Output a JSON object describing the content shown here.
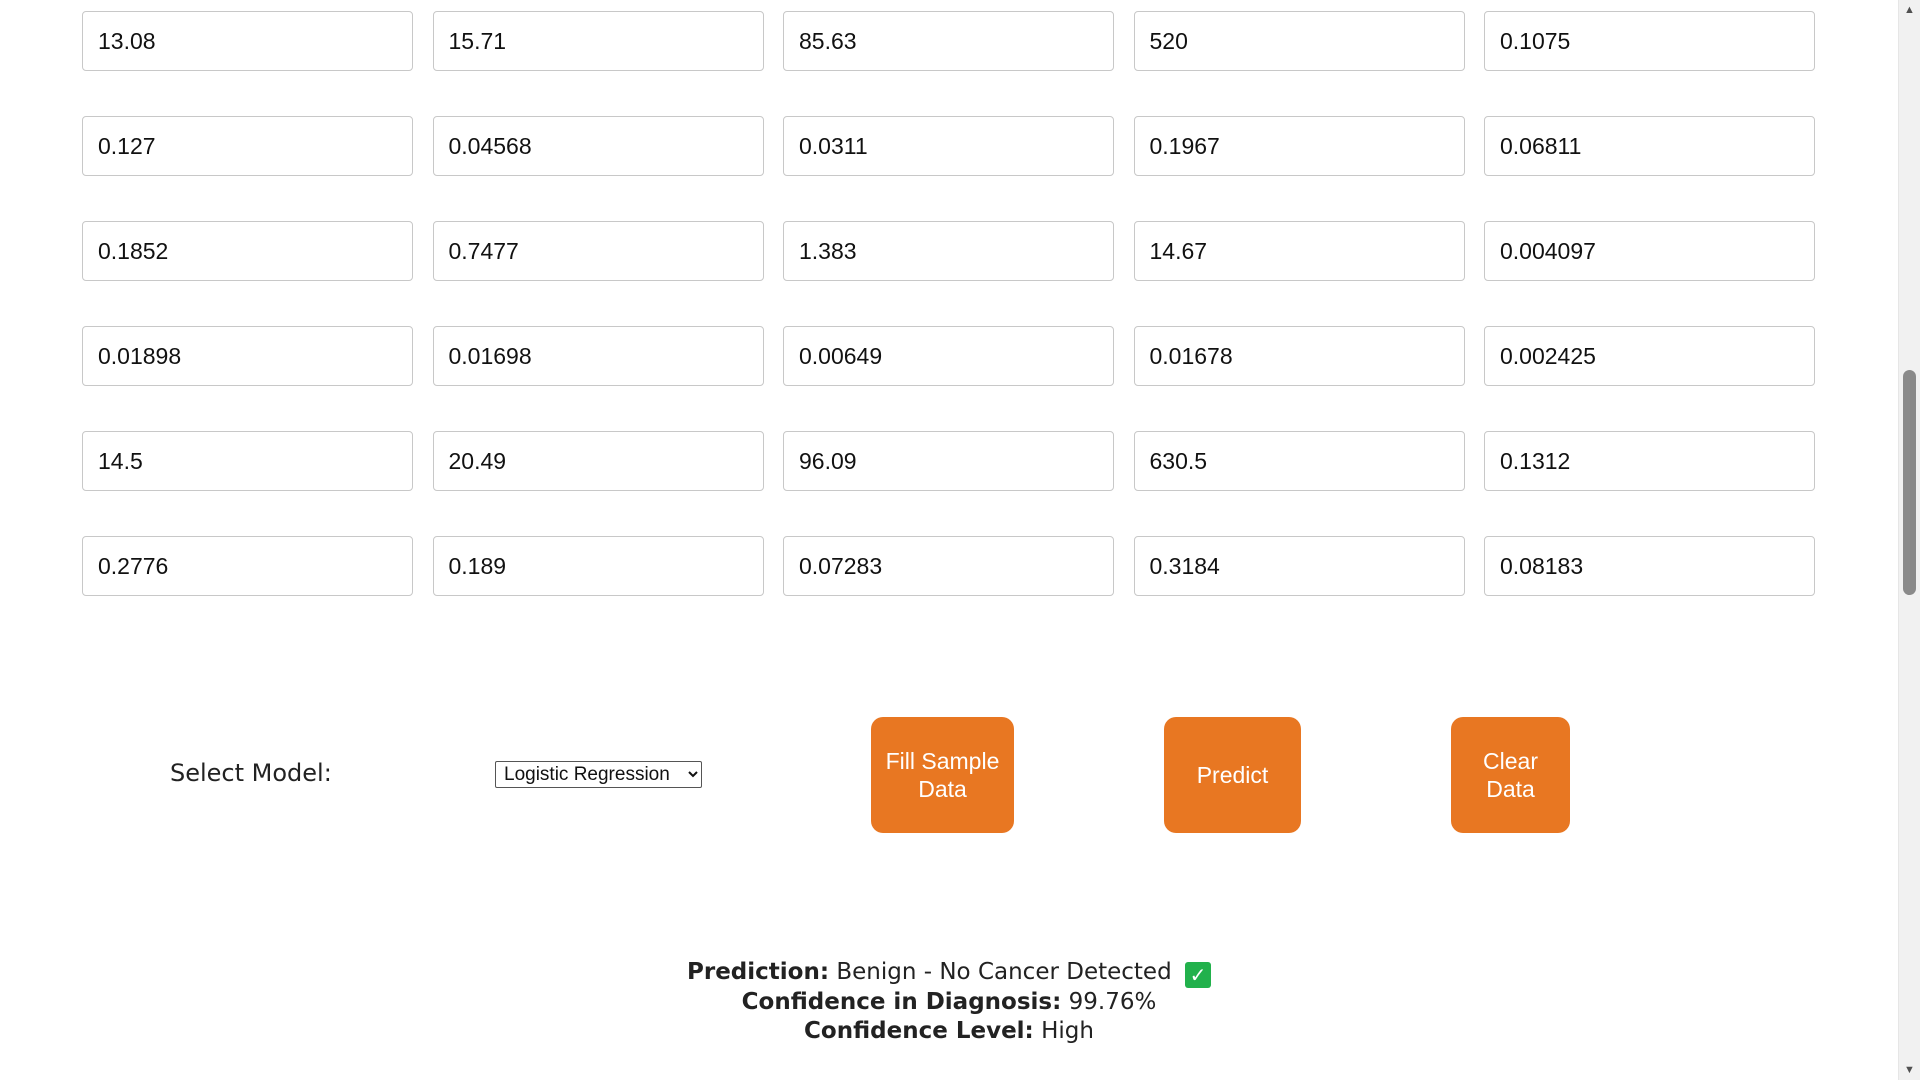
{
  "inputs": [
    "13.08",
    "15.71",
    "85.63",
    "520",
    "0.1075",
    "0.127",
    "0.04568",
    "0.0311",
    "0.1967",
    "0.06811",
    "0.1852",
    "0.7477",
    "1.383",
    "14.67",
    "0.004097",
    "0.01898",
    "0.01698",
    "0.00649",
    "0.01678",
    "0.002425",
    "14.5",
    "20.49",
    "96.09",
    "630.5",
    "0.1312",
    "0.2776",
    "0.189",
    "0.07283",
    "0.3184",
    "0.08183"
  ],
  "controls": {
    "select_label": "Select Model:",
    "model_selected": "Logistic Regression",
    "fill_button": "Fill Sample Data",
    "predict_button": "Predict",
    "clear_button": "Clear Data"
  },
  "result": {
    "prediction_label": "Prediction:",
    "prediction_value": "Benign - No Cancer Detected",
    "confidence_label": "Confidence in Diagnosis:",
    "confidence_value": "99.76%",
    "level_label": "Confidence Level:",
    "level_value": "High",
    "check_icon": "✓"
  },
  "colors": {
    "button_accent": "#e87722",
    "check_green": "#22b14c"
  }
}
